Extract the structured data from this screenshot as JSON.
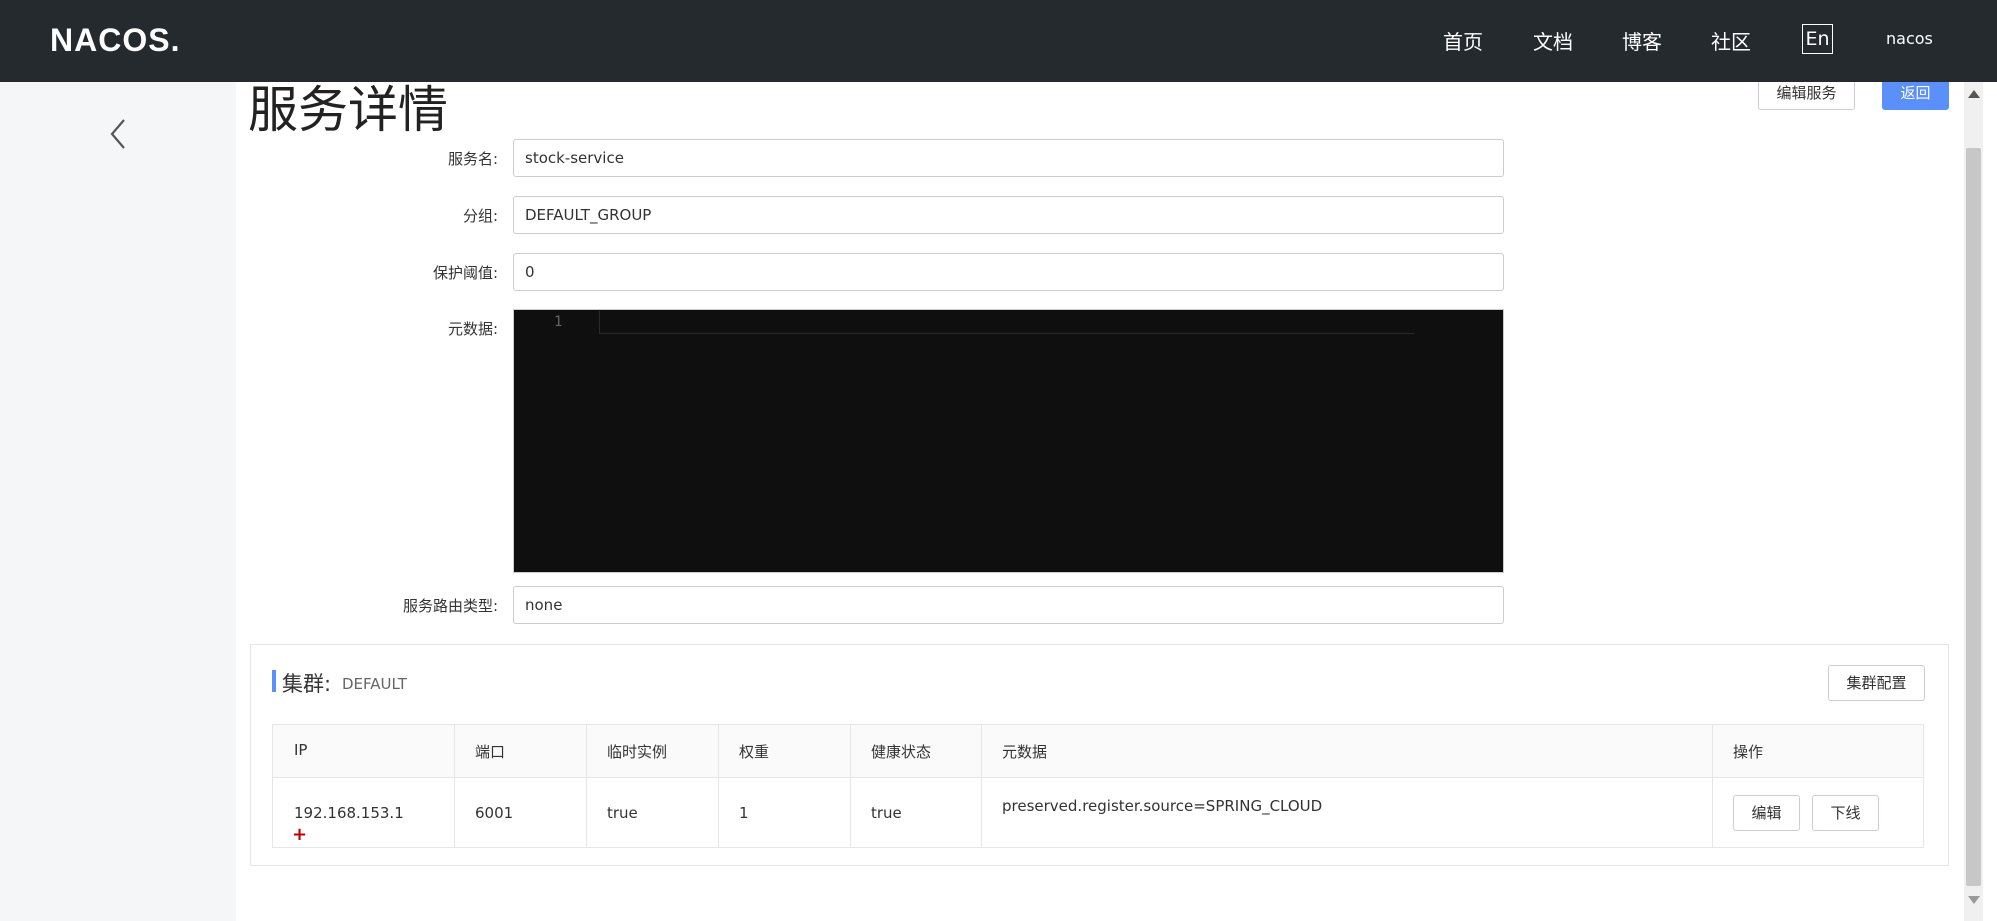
{
  "app": {
    "logo": "NACOS."
  },
  "nav": {
    "items": [
      "首页",
      "文档",
      "博客",
      "社区"
    ],
    "lang": "En",
    "user": "nacos"
  },
  "page": {
    "title": "服务详情",
    "edit_service_label": "编辑服务",
    "back_label": "返回"
  },
  "form": {
    "service_name_label": "服务名:",
    "service_name_value": "stock-service",
    "group_label": "分组:",
    "group_value": "DEFAULT_GROUP",
    "threshold_label": "保护阈值:",
    "threshold_value": "0",
    "metadata_label": "元数据:",
    "metadata_line_number": "1",
    "selector_label": "服务路由类型:",
    "selector_value": "none"
  },
  "cluster": {
    "title": "集群:",
    "name": "DEFAULT",
    "config_label": "集群配置",
    "columns": [
      "IP",
      "端口",
      "临时实例",
      "权重",
      "健康状态",
      "元数据",
      "操作"
    ],
    "rows": [
      {
        "ip": "192.168.153.1",
        "port": "6001",
        "ephemeral": "true",
        "weight": "1",
        "healthy": "true",
        "metadata": "preserved.register.source=SPRING_CLOUD",
        "edit_label": "编辑",
        "offline_label": "下线"
      }
    ]
  },
  "colors": {
    "topbar": "#252a2f",
    "primary": "#5b8ff9",
    "editor_bg": "#0f0f0f"
  }
}
